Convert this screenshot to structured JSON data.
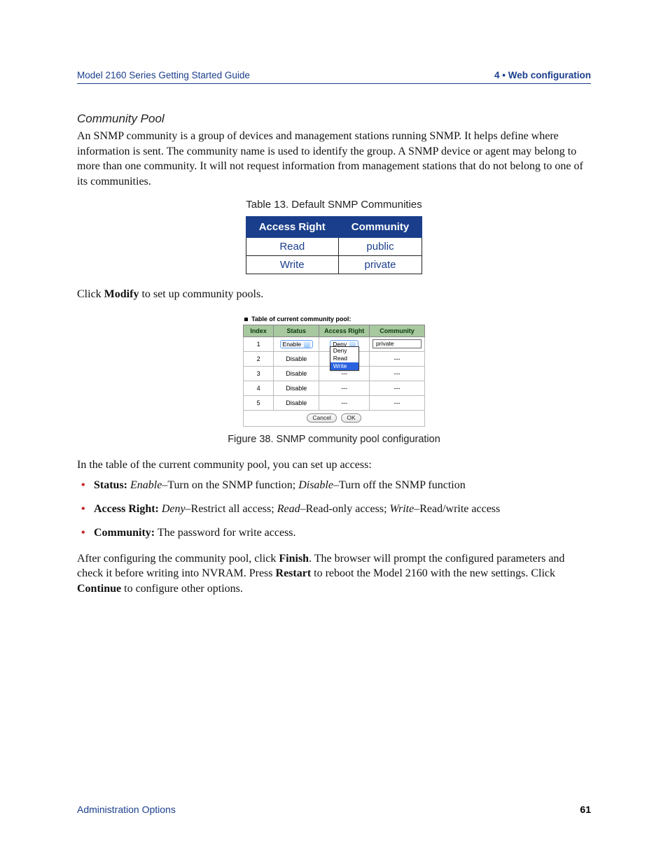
{
  "header": {
    "left": "Model 2160 Series Getting Started Guide",
    "right": "4 • Web configuration"
  },
  "section": {
    "title": "Community Pool"
  },
  "para1": "An SNMP community is a group of devices and management stations running SNMP. It helps define where information is sent. The community name is used to identify the group. A SNMP device or agent may belong to more than one community. It will not request information from management stations that do not belong to one of its communities.",
  "table13": {
    "caption": "Table 13. Default SNMP Communities",
    "headers": [
      "Access Right",
      "Community"
    ],
    "rows": [
      [
        "Read",
        "public"
      ],
      [
        "Write",
        "private"
      ]
    ]
  },
  "para2_pre": "Click ",
  "para2_bold": "Modify",
  "para2_post": " to set up community pools.",
  "figure": {
    "title": "Table of current community pool:",
    "headers": [
      "Index",
      "Status",
      "Access Right",
      "Community"
    ],
    "row1": {
      "index": "1",
      "status_value": "Enable",
      "access_value": "Deny",
      "dropdown_items": [
        "Deny",
        "Read",
        "Write"
      ],
      "community_value": "private"
    },
    "rows_rest": [
      {
        "index": "2",
        "status": "Disable",
        "access": "---",
        "community": "---"
      },
      {
        "index": "3",
        "status": "Disable",
        "access": "---",
        "community": "---"
      },
      {
        "index": "4",
        "status": "Disable",
        "access": "---",
        "community": "---"
      },
      {
        "index": "5",
        "status": "Disable",
        "access": "---",
        "community": "---"
      }
    ],
    "buttons": {
      "cancel": "Cancel",
      "ok": "OK"
    },
    "caption": "Figure 38. SNMP community pool configuration"
  },
  "para3": "In the table of the current community pool, you can set up access:",
  "bullets": [
    {
      "label": "Status:",
      "rich": " <i>Enable</i>–Turn on the SNMP function; <i>Disable</i>–Turn off the SNMP function"
    },
    {
      "label": "Access Right:",
      "rich": " <i>Deny</i>–Restrict all access; <i>Read</i>–Read-only access; <i>Write</i>–Read/write access"
    },
    {
      "label": "Community:",
      "rich": "  The password for write access."
    }
  ],
  "para4": {
    "t1": "After configuring the community pool, click ",
    "b1": "Finish",
    "t2": ". The browser will prompt the configured parameters and check it before writing into NVRAM. Press ",
    "b2": "Restart",
    "t3": " to reboot the Model 2160 with the new settings. Click ",
    "b3": "Continue",
    "t4": " to configure other options."
  },
  "footer": {
    "left": "Administration Options",
    "right": "61"
  }
}
